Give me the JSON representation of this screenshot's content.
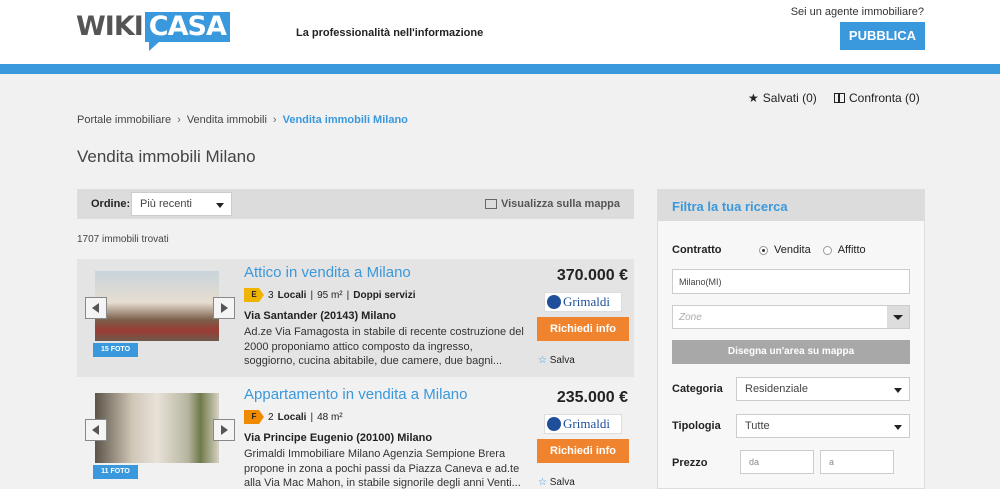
{
  "header": {
    "logo_wiki": "WIKI",
    "logo_casa": "CASA",
    "tagline": "La professionalità nell'informazione",
    "agent_question": "Sei un agente immobiliare?",
    "publish_button": "PUBBLICA",
    "accent_color": "#3a98dc"
  },
  "toplinks": {
    "saved": "Salvati (0)",
    "compare": "Confronta (0)"
  },
  "breadcrumb": [
    "Portale immobiliare",
    "Vendita immobili",
    "Vendita immobili Milano"
  ],
  "page_title": "Vendita immobili Milano",
  "sortbar": {
    "label": "Ordine:",
    "selected": "Più recenti",
    "map_link": "Visualizza sulla mappa"
  },
  "results_count": "1707 immobili trovati",
  "listings": [
    {
      "title": "Attico in vendita a Milano",
      "energy_class": "E",
      "rooms": "3",
      "rooms_label": "Locali",
      "area": "95 m²",
      "extra": "Doppi servizi",
      "address": "Via Santander (20143) Milano",
      "description": "Ad.ze Via Famagosta in stabile di recente costruzione del 2000 proponiamo attico composto da ingresso, soggiorno, cucina abitabile, due camere, due bagni...",
      "price": "370.000 €",
      "photos": "15 FOTO",
      "agency": "Grimaldi",
      "info_button": "Richiedi info",
      "save_label": "Salva"
    },
    {
      "title": "Appartamento in vendita a Milano",
      "energy_class": "F",
      "rooms": "2",
      "rooms_label": "Locali",
      "area": "48 m²",
      "extra": "",
      "address": "Via Principe Eugenio (20100) Milano",
      "description": "Grimaldi Immobiliare Milano Agenzia Sempione Brera propone in zona a pochi passi da Piazza Caneva e ad.te alla Via Mac Mahon, in stabile signorile degli anni Venti...",
      "price": "235.000 €",
      "photos": "11 FOTO",
      "agency": "Grimaldi",
      "info_button": "Richiedi info",
      "save_label": "Salva"
    }
  ],
  "filter": {
    "title": "Filtra la tua ricerca",
    "contract_label": "Contratto",
    "contract_options": [
      "Vendita",
      "Affitto"
    ],
    "city_value": "Milano(MI)",
    "zone_placeholder": "Zone",
    "draw_button": "Disegna un'area su mappa",
    "category_label": "Categoria",
    "category_value": "Residenziale",
    "type_label": "Tipologia",
    "type_value": "Tutte",
    "price_label": "Prezzo",
    "price_from_placeholder": "da",
    "price_to_placeholder": "a"
  }
}
